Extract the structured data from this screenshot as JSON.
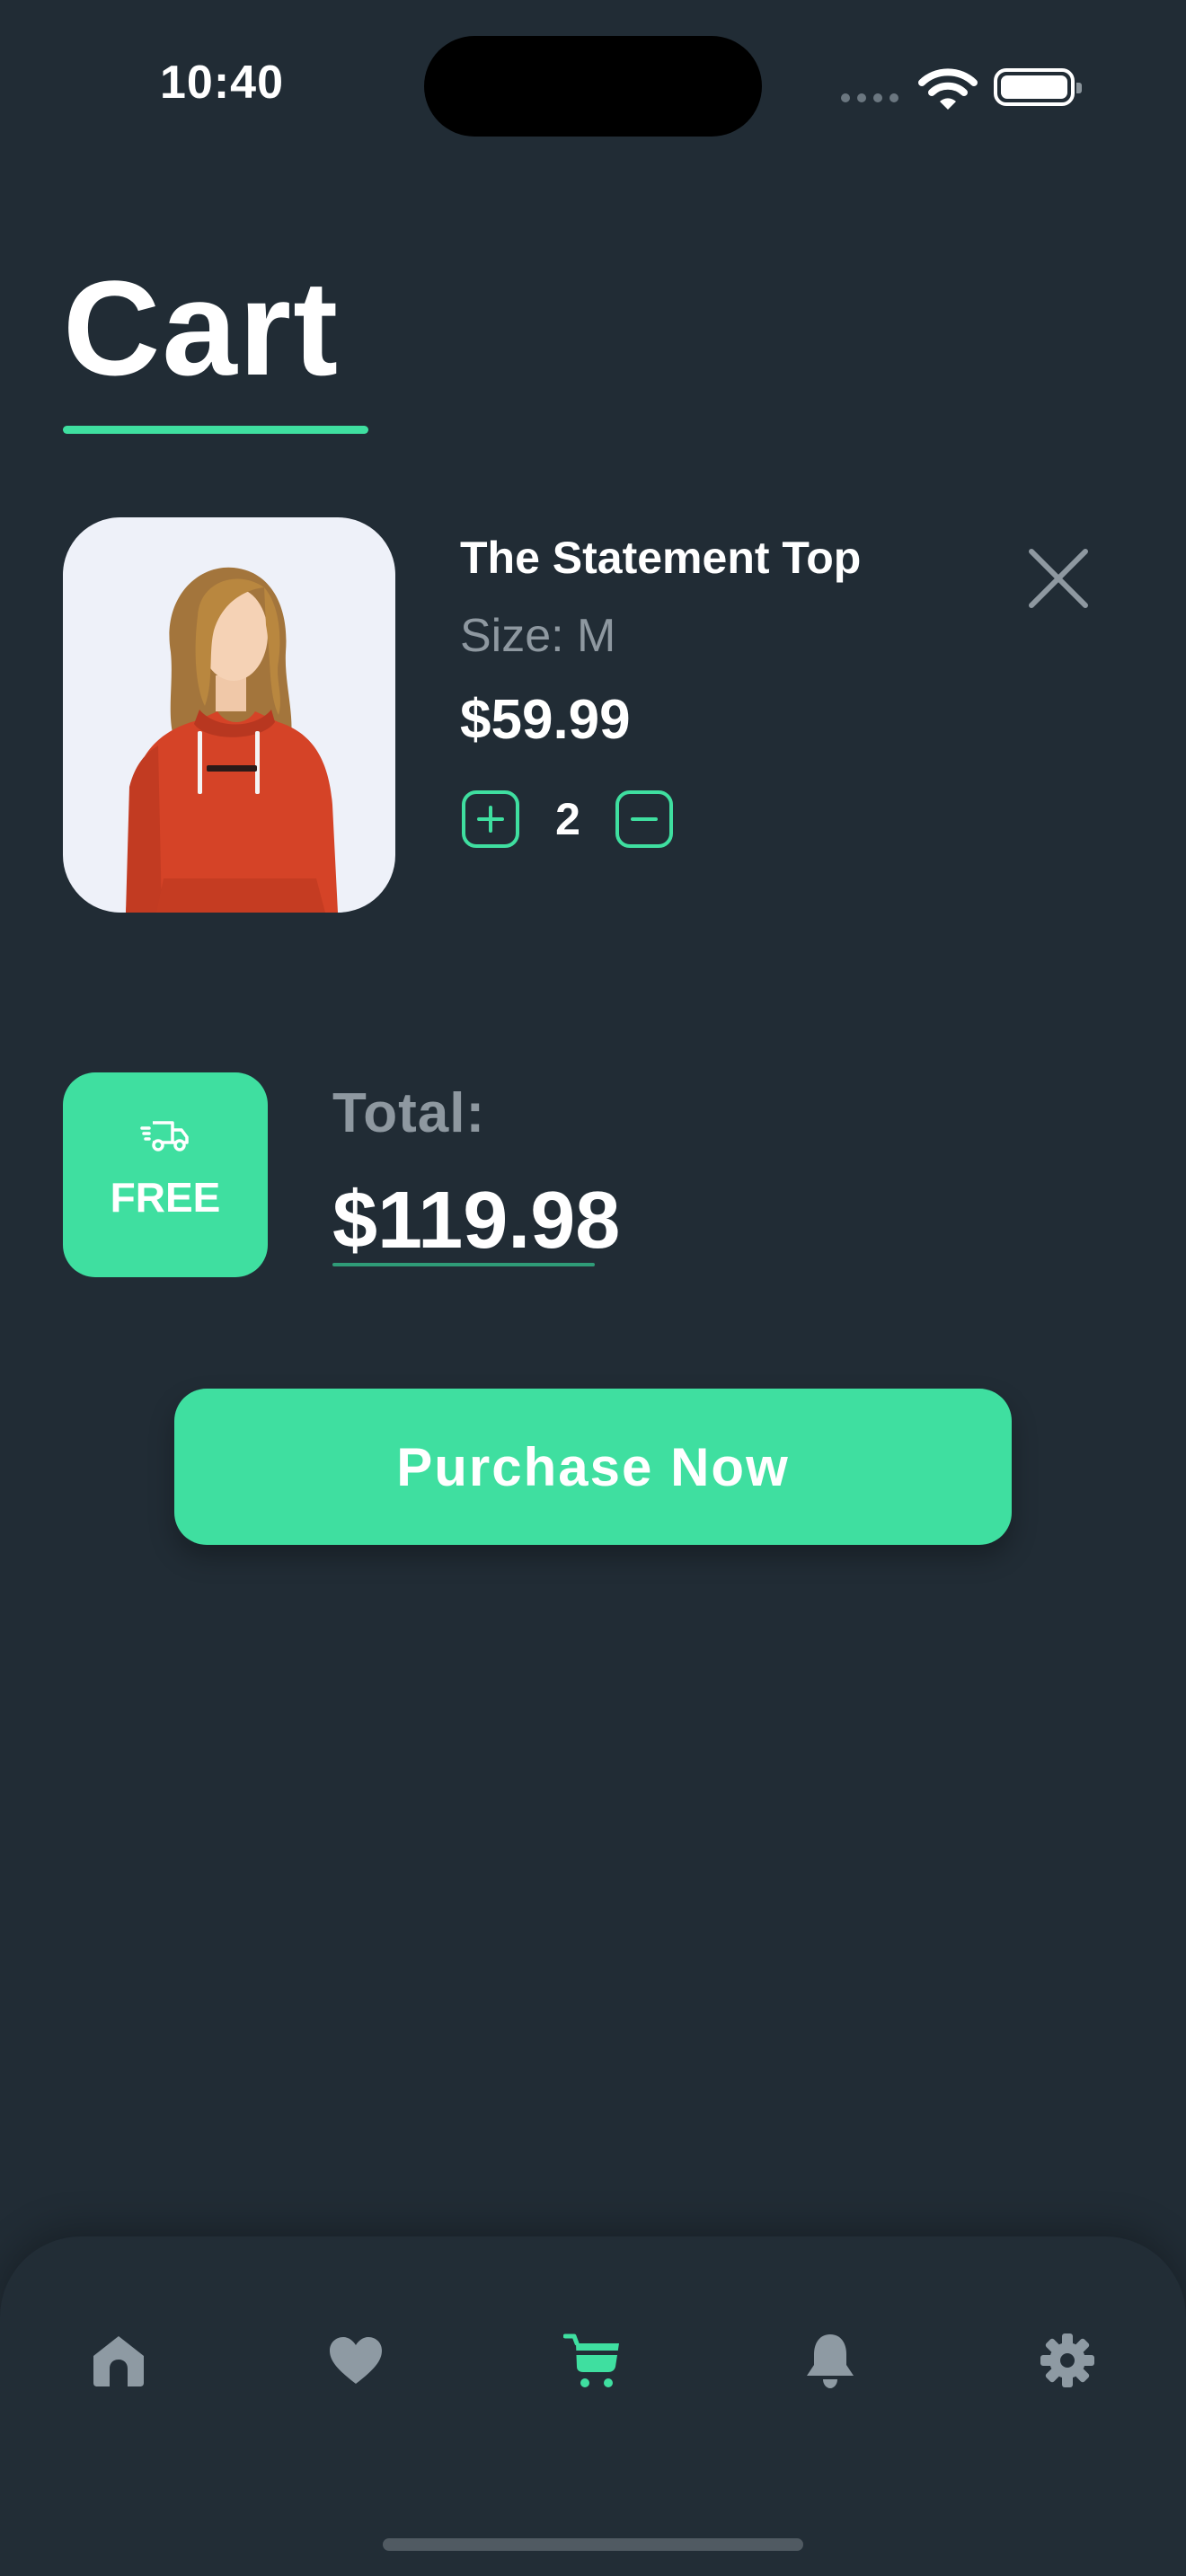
{
  "status_bar": {
    "time": "10:40"
  },
  "page": {
    "title": "Cart"
  },
  "cart_item": {
    "name": "The Statement Top",
    "size": "Size: M",
    "price": "$59.99",
    "quantity": "2",
    "image_icon": "hoodie-model-photo"
  },
  "summary": {
    "shipping_label": "FREE",
    "total_label": "Total:",
    "total_value": "$119.98"
  },
  "actions": {
    "purchase_label": "Purchase Now"
  },
  "bottom_nav": {
    "items": [
      {
        "icon": "home-icon",
        "active": false
      },
      {
        "icon": "heart-icon",
        "active": false
      },
      {
        "icon": "cart-icon",
        "active": true
      },
      {
        "icon": "bell-icon",
        "active": false
      },
      {
        "icon": "gear-icon",
        "active": false
      }
    ]
  },
  "colors": {
    "background": "#212c35",
    "accent": "#3fdfa0",
    "muted_text": "#8e98a0",
    "inactive_icon": "#8e9aa3"
  }
}
